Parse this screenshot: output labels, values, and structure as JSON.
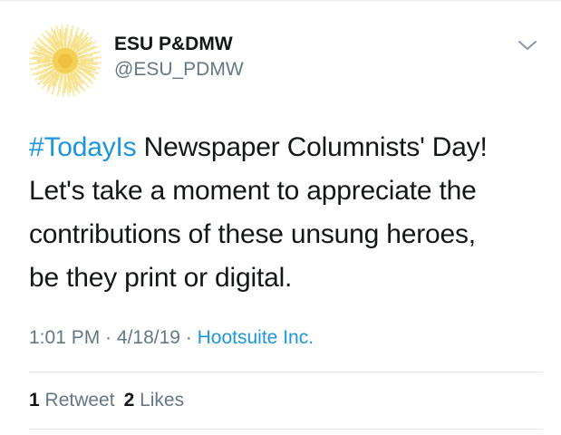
{
  "author": {
    "display_name": "ESU P&DMW",
    "handle": "@ESU_PDMW",
    "avatar_icon": "yellow-dandelion-avatar"
  },
  "menu": {
    "icon": "chevron-down-icon"
  },
  "tweet": {
    "hashtag": "#TodayIs",
    "line1_rest": " Newspaper Columnists' Day!",
    "line2": "Let's take a moment to appreciate the",
    "line3": "contributions of these unsung heroes,",
    "line4": "be they print or digital."
  },
  "meta": {
    "time": "1:01 PM",
    "sep1": " · ",
    "date": "4/18/19",
    "sep2": " · ",
    "source": "Hootsuite Inc."
  },
  "stats": {
    "retweet_count": "1",
    "retweet_label": " Retweet",
    "like_count": "2",
    "like_label": " Likes"
  },
  "colors": {
    "link": "#1b95e0",
    "secondary_text": "#657786",
    "primary_text": "#14171a",
    "divider": "#e1e8ed",
    "avatar_yellow": "#f7e08a"
  }
}
